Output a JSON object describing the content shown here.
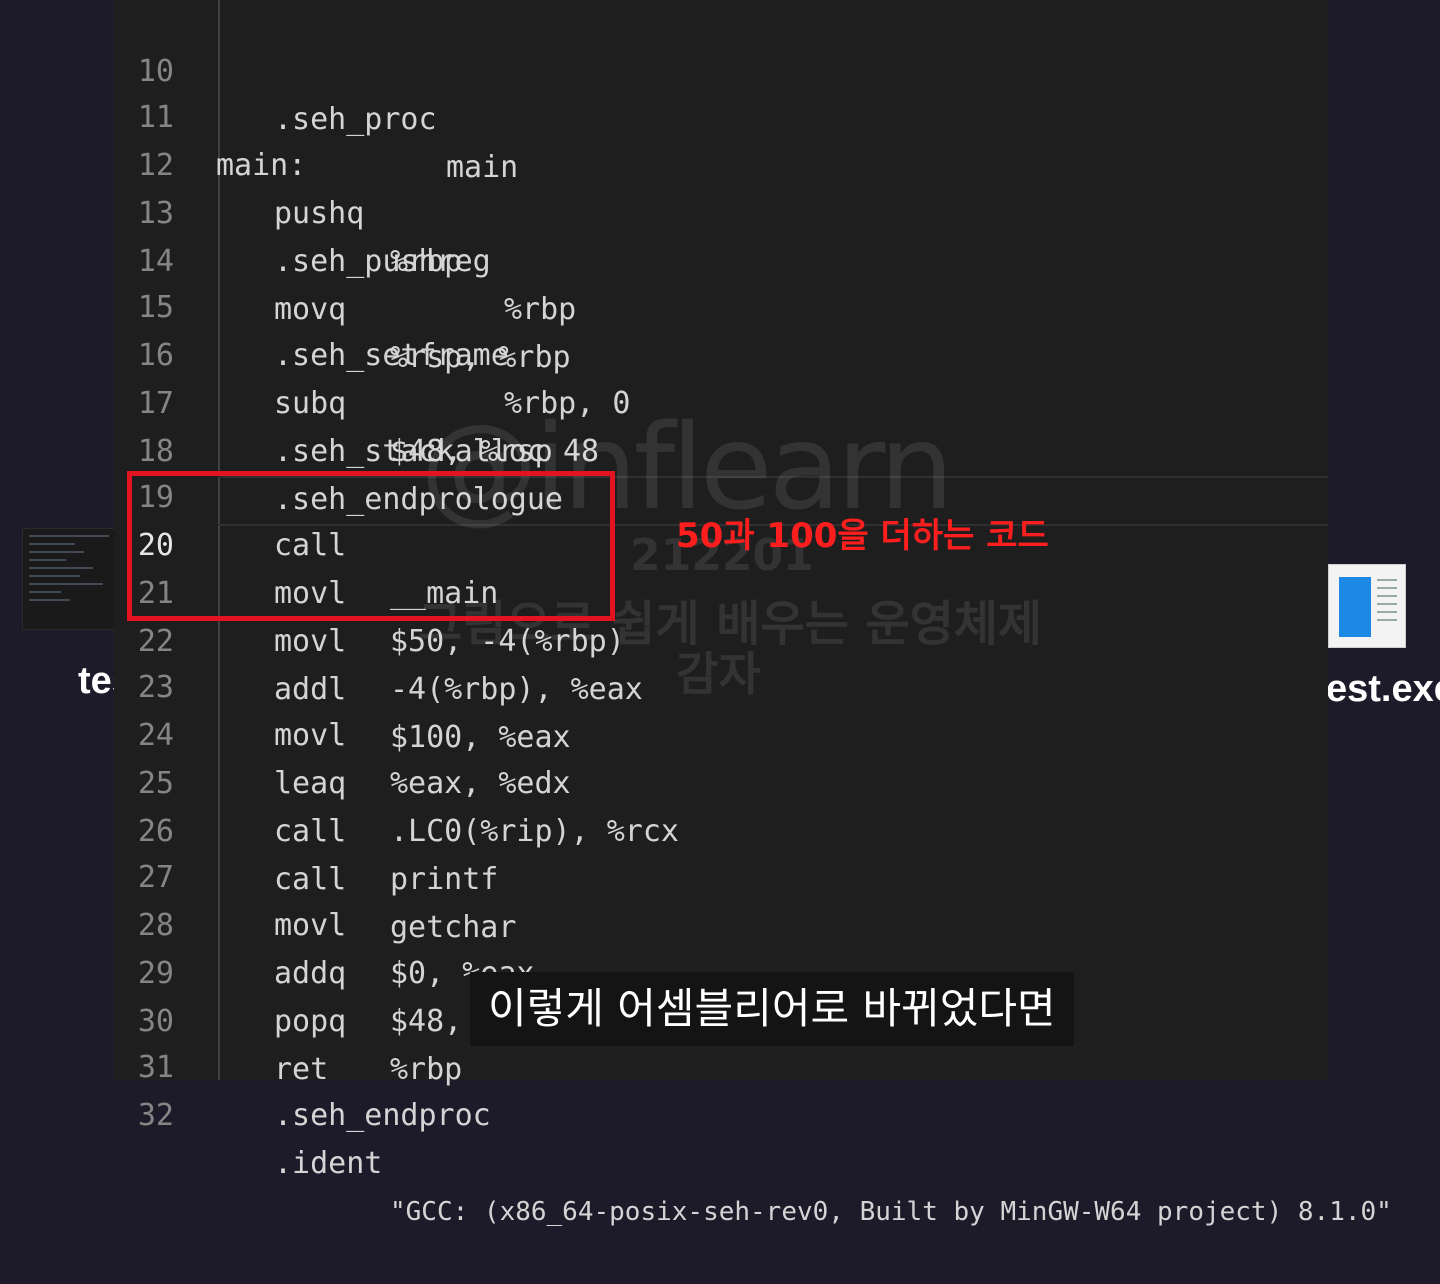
{
  "desktop": {
    "left_label": "tes",
    "right_label": "est.exe"
  },
  "editor": {
    "lines": [
      {
        "num": "10",
        "instr": ".seh_proc",
        "operand": "main"
      },
      {
        "num": "11",
        "label": "main:"
      },
      {
        "num": "12",
        "instr": "pushq",
        "operand": "%rbp"
      },
      {
        "num": "13",
        "instr": ".seh_pushreg",
        "operand": "%rbp"
      },
      {
        "num": "14",
        "instr": "movq",
        "operand": "%rsp, %rbp"
      },
      {
        "num": "15",
        "instr": ".seh_setframe",
        "operand": "%rbp, 0"
      },
      {
        "num": "16",
        "instr": "subq",
        "operand": "$48, %rsp"
      },
      {
        "num": "17",
        "instr": ".seh_stackalloc 48"
      },
      {
        "num": "18",
        "instr": ".seh_endprologue"
      },
      {
        "num": "19",
        "instr": "call",
        "operand": "__main"
      },
      {
        "num": "20",
        "instr": "movl",
        "operand": "$50, -4(%rbp)"
      },
      {
        "num": "21",
        "instr": "movl",
        "operand": "-4(%rbp), %eax"
      },
      {
        "num": "22",
        "instr": "addl",
        "operand": "$100, %eax"
      },
      {
        "num": "23",
        "instr": "movl",
        "operand": "%eax, %edx"
      },
      {
        "num": "24",
        "instr": "leaq",
        "operand": ".LC0(%rip), %rcx"
      },
      {
        "num": "25",
        "instr": "call",
        "operand": "printf"
      },
      {
        "num": "26",
        "instr": "call",
        "operand": "getchar"
      },
      {
        "num": "27",
        "instr": "movl",
        "operand": "$0, %eax"
      },
      {
        "num": "28",
        "instr": "addq",
        "operand": "$48, %rsp"
      },
      {
        "num": "29",
        "instr": "popq",
        "operand": "%rbp"
      },
      {
        "num": "30",
        "instr": "ret"
      },
      {
        "num": "31",
        "instr": ".seh_endproc"
      },
      {
        "num": "32",
        "instr": ".ident",
        "operand": "\"GCC: (x86_64-posix-seh-rev0, Built by MinGW-W64 project) 8.1.0\""
      }
    ]
  },
  "annotation": {
    "text": "50과 100을 더하는 코드",
    "color": "#e3131f"
  },
  "watermark": {
    "logo": "@inflearn",
    "id": "212201",
    "course": "그림으로 쉽게 배우는 운영체제",
    "author": "감자"
  },
  "subtitle": {
    "text": "이렇게 어셈블리어로 바뀌었다면"
  }
}
